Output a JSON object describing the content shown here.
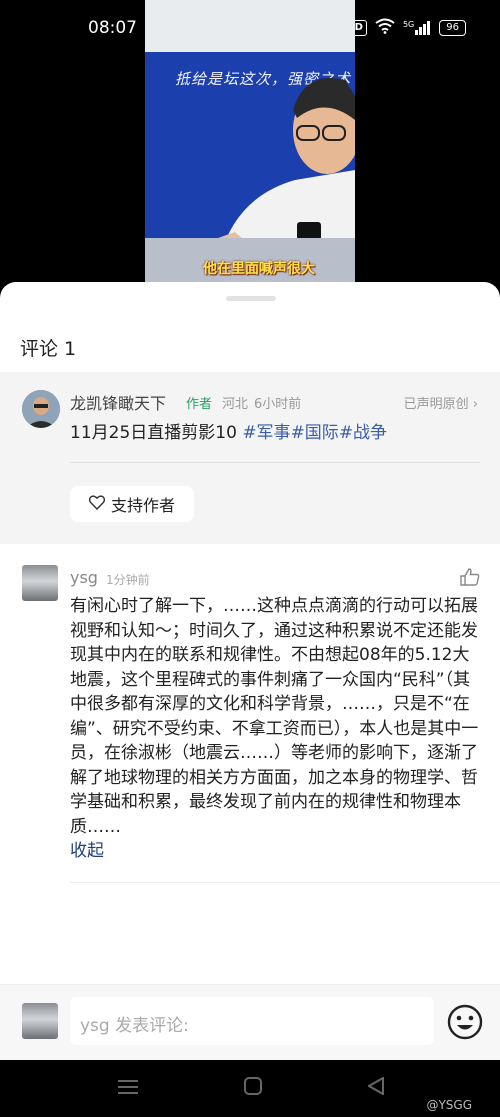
{
  "status_bar": {
    "time": "08:07",
    "nfc_label": "N",
    "hd_label": "HD",
    "signal_label": "5G",
    "battery": "96"
  },
  "video": {
    "board_text": "抵给是坛这次，强密之术",
    "subtitle": "他在里面喊声很大"
  },
  "comments_header": "评论 1",
  "post": {
    "author": "龙凯锋瞰天下",
    "author_tag": "作者",
    "location": "河北",
    "time": "6小时前",
    "original_label": "已声明原创",
    "content_text": "11月25日直播剪影10 ",
    "hashtags": [
      "#军事",
      "#国际",
      "#战争"
    ],
    "support_label": "支持作者"
  },
  "comment": {
    "user": "ysg",
    "time": "1分钟前",
    "body": "有闲心时了解一下，……这种点点滴滴的行动可以拓展视野和认知～；时间久了，通过这种积累说不定还能发现其中内在的联系和规律性。不由想起08年的5.12大地震，这个里程碑式的事件刺痛了一众国内“民科”（其中很多都有深厚的文化和科学背景，……，只是不“在编”、研究不受约束、不拿工资而已），本人也是其中一员，在徐淑彬（地震云……）等老师的影响下，逐渐了解了地球物理的相关方方面面，加之本身的物理学、哲学基础和积累，最终发现了前内在的规律性和物理本质……",
    "collapse_label": "收起"
  },
  "input": {
    "placeholder": "ysg 发表评论:"
  },
  "nav": {
    "menu_icon": "menu-icon",
    "home_icon": "home-icon",
    "back_icon": "back-icon",
    "watermark": "@YSGG"
  },
  "colors": {
    "author_tag": "#29a163",
    "hashtag": "#3a5ea8",
    "collapse": "#1f3f7a",
    "subtitle": "#ffe14a",
    "board": "#1c3fae"
  }
}
